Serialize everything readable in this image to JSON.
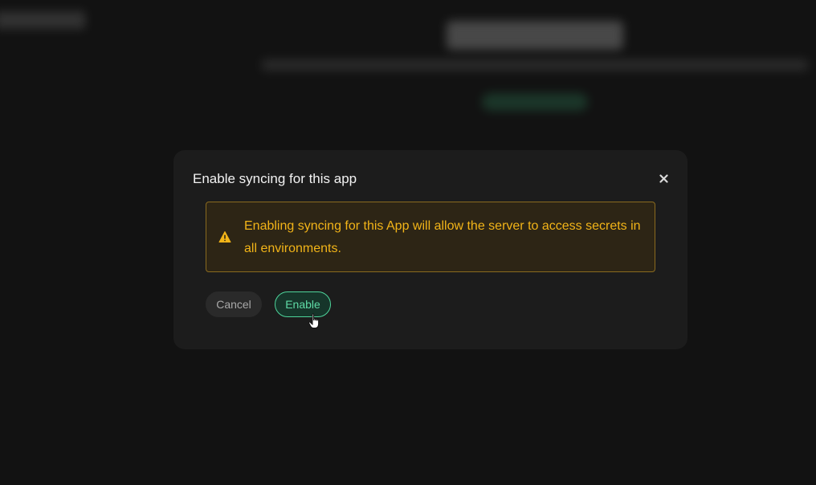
{
  "dialog": {
    "title": "Enable syncing for this app",
    "close_icon": "close-icon",
    "alert": {
      "icon": "warning-triangle-icon",
      "text": "Enabling syncing for this App will allow the server to access secrets in all environments."
    },
    "cancel_label": "Cancel",
    "enable_label": "Enable"
  },
  "colors": {
    "background": "#121212",
    "dialog": "#1c1c1c",
    "warning_text": "#f2b418",
    "warning_border": "#8a6a1f",
    "accent": "#4ed49b"
  }
}
